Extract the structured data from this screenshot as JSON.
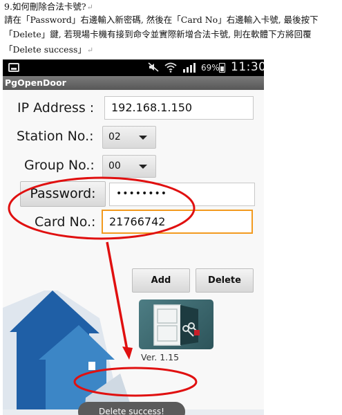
{
  "document": {
    "question_title": "9.如何刪除合法卡號?",
    "line1": "請在「Password」右邊輸入新密碼, 然後在「Card No」右邊輸入卡號, 最後按下",
    "line2": "「Delete」鍵, 若現場卡機有接到命令並實際新增合法卡號, 則在軟體下方將回覆",
    "line3": "「Delete success」",
    "paragraph_mark": "↵"
  },
  "status_bar": {
    "battery_percent": "69%",
    "battery_level": 0.69,
    "time": "11:30",
    "icons": [
      "screen-icon",
      "mute-icon",
      "wifi-icon",
      "signal-icon",
      "battery-icon"
    ]
  },
  "app": {
    "title": "PgOpenDoor",
    "ip_label": "IP Address :",
    "ip_value": "192.168.1.150",
    "station_label": "Station No.:",
    "station_value": "02",
    "group_label": "Group No.:",
    "group_value": "00",
    "password_button": "Password:",
    "password_value": "••••••••",
    "card_label": "Card No.:",
    "card_value": "21766742",
    "add_button": "Add",
    "delete_button": "Delete",
    "version": "Ver. 1.15",
    "toast": "Delete success!"
  },
  "colors": {
    "annotation_red": "#e01010",
    "focus_orange": "#f29a1e",
    "arrow_blue": "#1f5fa6",
    "arrow_light_blue": "#3c86c6"
  }
}
